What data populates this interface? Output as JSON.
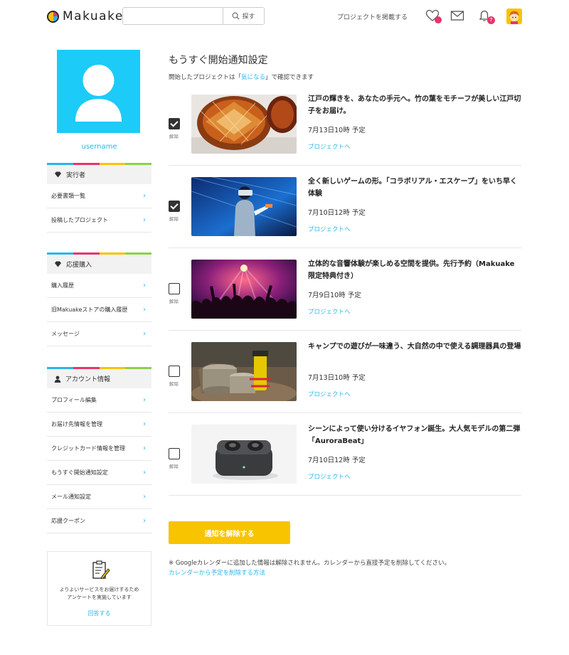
{
  "header": {
    "logo_text": "Makuake",
    "search_placeholder": "",
    "search_button": "探す",
    "post_project": "プロジェクトを掲載する",
    "notification_count": "7"
  },
  "sidebar": {
    "username": "username",
    "groups": [
      {
        "heading": "実行者",
        "items": [
          "必要書類一覧",
          "投稿したプロジェクト"
        ]
      },
      {
        "heading": "応援購入",
        "items": [
          "購入履歴",
          "旧Makuakeストアの購入履歴",
          "メッセージ"
        ]
      },
      {
        "heading": "アカウント情報",
        "items": [
          "プロフィール編集",
          "お届け先情報を管理",
          "クレジットカード情報を管理",
          "もうすぐ開始通知設定",
          "メール通知設定",
          "応援クーポン"
        ]
      }
    ],
    "survey": {
      "line1": "よりよいサービスをお届けするため",
      "line2": "アンケートを実施しています",
      "link": "回答する"
    }
  },
  "main": {
    "title": "もうすぐ開始通知設定",
    "subtitle_pre": "開始したプロジェクトは「",
    "subtitle_link": "気になる",
    "subtitle_post": "」で確認できます",
    "uncheck_label": "解除",
    "project_link": "プロジェクトへ",
    "projects": [
      {
        "title": "江戸の輝きを、あなたの手元へ。竹の葉をモチーフが美しい江戸切子をお届け。",
        "date": "7月13日10時 予定",
        "checked": true
      },
      {
        "title": "全く新しいゲームの形。「コラボリアル・エスケープ」をいち早く体験",
        "date": "7月10日12時 予定",
        "checked": true
      },
      {
        "title": "立体的な音響体験が楽しめる空間を提供。先行予約（Makuake限定特典付き）",
        "date": "7月9日10時 予定",
        "checked": false
      },
      {
        "title": "キャンプでの遊びが一味違う、大自然の中で使える調理器具の登場",
        "date": "7月13日10時 予定",
        "checked": false
      },
      {
        "title": "シーンによって使い分けるイヤフォン誕生。大人気モデルの第二弾「AuroraBeat」",
        "date": "7月10日12時 予定",
        "checked": false
      }
    ],
    "submit_button": "通知を解除する",
    "note": "※ Googleカレンダーに追加した情報は解除されません。カレンダーから直接予定を削除してください。",
    "note_link": "カレンダーから予定を削除する方法"
  },
  "colors": {
    "accent": "#2bb5e8",
    "brand_yellow": "#f8c400",
    "brand_pink": "#e8356b",
    "profile_bg": "#1ccbf7"
  }
}
